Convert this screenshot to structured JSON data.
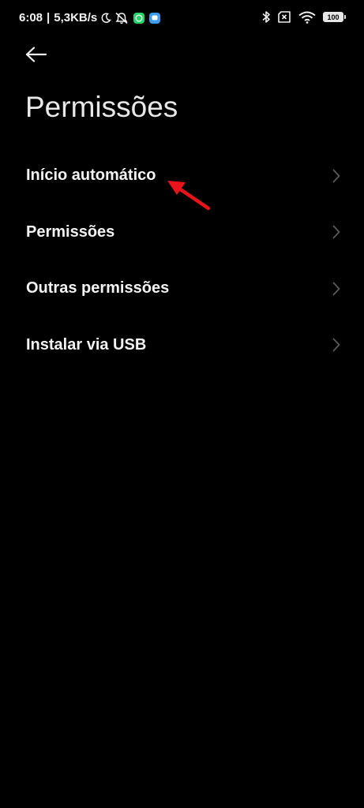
{
  "status_bar": {
    "time": "6:08",
    "separator": "|",
    "network_speed": "5,3KB/s",
    "battery": "100",
    "icons": [
      "moon-icon",
      "notifications-off-icon",
      "whatsapp-icon",
      "message-app-icon",
      "bluetooth-icon",
      "no-sim-icon",
      "wifi-icon",
      "battery-icon"
    ]
  },
  "header": {
    "back_icon": "arrow-left-icon",
    "title": "Permissões"
  },
  "menu": {
    "items": [
      {
        "label": "Início automático"
      },
      {
        "label": "Permissões"
      },
      {
        "label": "Outras permissões"
      },
      {
        "label": "Instalar via USB"
      }
    ]
  },
  "colors": {
    "background": "#000000",
    "text": "#f2f2f2",
    "chevron": "#5a5a5a",
    "annotation": "#e8141b",
    "whatsapp_badge": "#25d366",
    "message_badge": "#3d9bf0"
  }
}
